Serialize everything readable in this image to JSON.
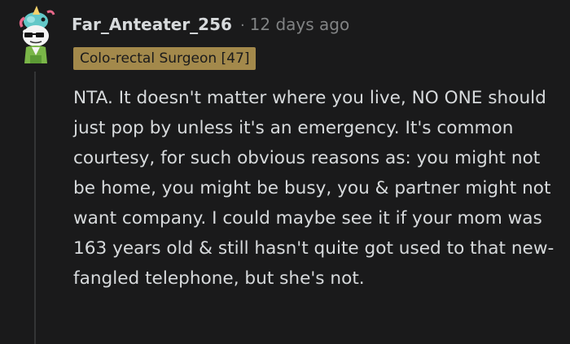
{
  "comment": {
    "author": "Far_Anteater_256",
    "separator": "·",
    "timestamp": "12 days ago",
    "flair": "Colo-rectal Surgeon [47]",
    "body": "NTA. It doesn't matter where you live, NO ONE should just pop by unless it's an emergency. It's common courtesy, for such obvious reasons as: you might not be home, you might be busy, you & partner might not want company. I could maybe see it if your mom was 163 years old & still hasn't quite got used to that new-fangled telephone, but she's not.",
    "avatar": "snoo-avatar-with-unicorn-hat-and-sunglasses"
  },
  "colors": {
    "background": "#1a1a1b",
    "text": "#d7dadc",
    "meta": "#818384",
    "flair_bg": "#a3894b",
    "thread_line": "#343536"
  }
}
